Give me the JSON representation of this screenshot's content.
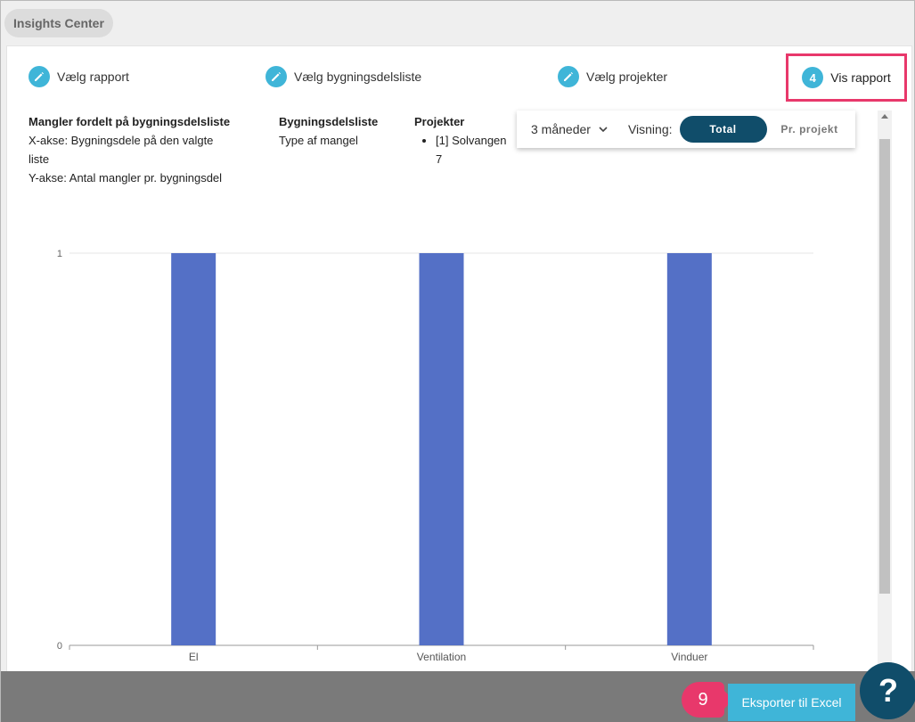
{
  "app": {
    "title": "Insights Center"
  },
  "stepper": {
    "steps": [
      {
        "label": "Vælg rapport"
      },
      {
        "label": "Vælg bygningsdelsliste"
      },
      {
        "label": "Vælg projekter"
      }
    ],
    "active": {
      "number": "4",
      "label": "Vis rapport"
    }
  },
  "info": {
    "report": {
      "heading": "Mangler fordelt på bygningsdelsliste",
      "line1": "X-akse: Bygningsdele på den valgte",
      "line2": "liste",
      "line3": "Y-akse: Antal mangler pr. bygningsdel"
    },
    "list": {
      "heading": "Bygningsdelsliste",
      "value": "Type af mangel"
    },
    "projects": {
      "heading": "Projekter",
      "item_line1": "[1] Solvangen",
      "item_line2": "7"
    }
  },
  "controls": {
    "period": "3 måneder",
    "visning_label": "Visning:",
    "toggle_total": "Total",
    "toggle_projekt": "Pr. projekt"
  },
  "chart_data": {
    "type": "bar",
    "categories": [
      "El",
      "Ventilation",
      "Vinduer"
    ],
    "values": [
      1,
      1,
      1
    ],
    "ylim": [
      0,
      1
    ],
    "yticks": [
      "0",
      "1"
    ],
    "bar_color": "#5470c6"
  },
  "footer": {
    "step_badge": "9",
    "export_label": "Eksporter til Excel",
    "help_label": "?"
  },
  "colors": {
    "accent": "#3fb5d8",
    "highlight": "#e8386b",
    "dark": "#104d6a"
  }
}
